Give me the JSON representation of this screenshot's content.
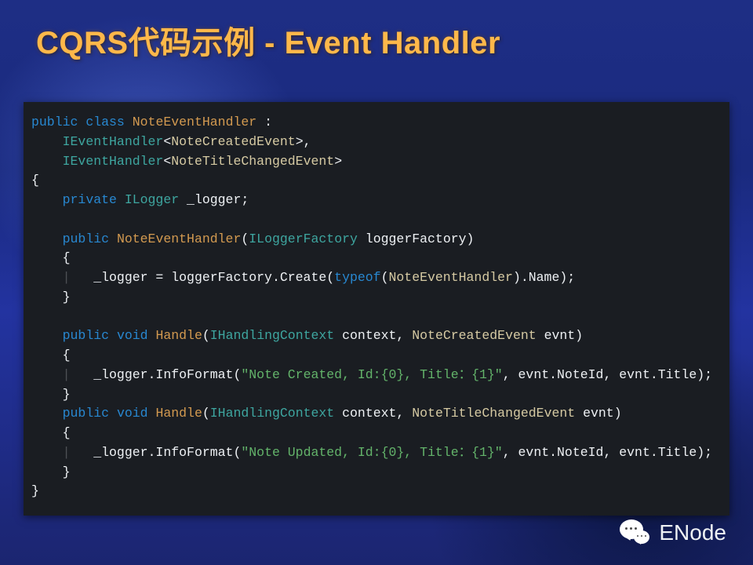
{
  "title": "CQRS代码示例 - Event Handler",
  "footer": {
    "label": "ENode"
  },
  "code": {
    "lines": [
      [
        [
          "kw",
          "public"
        ],
        [
          "pun",
          " "
        ],
        [
          "kw",
          "class"
        ],
        [
          "pun",
          " "
        ],
        [
          "name",
          "NoteEventHandler"
        ],
        [
          "pun",
          " :"
        ]
      ],
      [
        [
          "guide",
          "    "
        ],
        [
          "typ",
          "IEventHandler"
        ],
        [
          "pun",
          "<"
        ],
        [
          "typ2",
          "NoteCreatedEvent"
        ],
        [
          "pun",
          ">,"
        ]
      ],
      [
        [
          "guide",
          "    "
        ],
        [
          "typ",
          "IEventHandler"
        ],
        [
          "pun",
          "<"
        ],
        [
          "typ2",
          "NoteTitleChangedEvent"
        ],
        [
          "pun",
          ">"
        ]
      ],
      [
        [
          "pun",
          "{"
        ]
      ],
      [
        [
          "guide",
          "    "
        ],
        [
          "kw",
          "private"
        ],
        [
          "pun",
          " "
        ],
        [
          "typ",
          "ILogger"
        ],
        [
          "pun",
          " _logger;"
        ]
      ],
      [
        [
          "pun",
          " "
        ]
      ],
      [
        [
          "guide",
          "    "
        ],
        [
          "kw",
          "public"
        ],
        [
          "pun",
          " "
        ],
        [
          "name",
          "NoteEventHandler"
        ],
        [
          "pun",
          "("
        ],
        [
          "typ",
          "ILoggerFactory"
        ],
        [
          "pun",
          " loggerFactory)"
        ]
      ],
      [
        [
          "guide",
          "    "
        ],
        [
          "pun",
          "{"
        ]
      ],
      [
        [
          "guide",
          "    |   "
        ],
        [
          "pun",
          "_logger = loggerFactory.Create("
        ],
        [
          "kw",
          "typeof"
        ],
        [
          "pun",
          "("
        ],
        [
          "typ2",
          "NoteEventHandler"
        ],
        [
          "pun",
          ").Name);"
        ]
      ],
      [
        [
          "guide",
          "    "
        ],
        [
          "pun",
          "}"
        ]
      ],
      [
        [
          "pun",
          " "
        ]
      ],
      [
        [
          "guide",
          "    "
        ],
        [
          "kw",
          "public"
        ],
        [
          "pun",
          " "
        ],
        [
          "kw",
          "void"
        ],
        [
          "pun",
          " "
        ],
        [
          "name",
          "Handle"
        ],
        [
          "pun",
          "("
        ],
        [
          "typ",
          "IHandlingContext"
        ],
        [
          "pun",
          " context, "
        ],
        [
          "typ2",
          "NoteCreatedEvent"
        ],
        [
          "pun",
          " evnt)"
        ]
      ],
      [
        [
          "guide",
          "    "
        ],
        [
          "pun",
          "{"
        ]
      ],
      [
        [
          "guide",
          "    |   "
        ],
        [
          "pun",
          "_logger.InfoFormat("
        ],
        [
          "str",
          "\"Note Created, Id:{0}, Title：{1}\""
        ],
        [
          "pun",
          ", evnt.NoteId, evnt.Title);"
        ]
      ],
      [
        [
          "guide",
          "    "
        ],
        [
          "pun",
          "}"
        ]
      ],
      [
        [
          "guide",
          "    "
        ],
        [
          "kw",
          "public"
        ],
        [
          "pun",
          " "
        ],
        [
          "kw",
          "void"
        ],
        [
          "pun",
          " "
        ],
        [
          "name",
          "Handle"
        ],
        [
          "pun",
          "("
        ],
        [
          "typ",
          "IHandlingContext"
        ],
        [
          "pun",
          " context, "
        ],
        [
          "typ2",
          "NoteTitleChangedEvent"
        ],
        [
          "pun",
          " evnt)"
        ]
      ],
      [
        [
          "guide",
          "    "
        ],
        [
          "pun",
          "{"
        ]
      ],
      [
        [
          "guide",
          "    |   "
        ],
        [
          "pun",
          "_logger.InfoFormat("
        ],
        [
          "str",
          "\"Note Updated, Id:{0}, Title：{1}\""
        ],
        [
          "pun",
          ", evnt.NoteId, evnt.Title);"
        ]
      ],
      [
        [
          "guide",
          "    "
        ],
        [
          "pun",
          "}"
        ]
      ],
      [
        [
          "pun",
          "}"
        ]
      ]
    ]
  }
}
